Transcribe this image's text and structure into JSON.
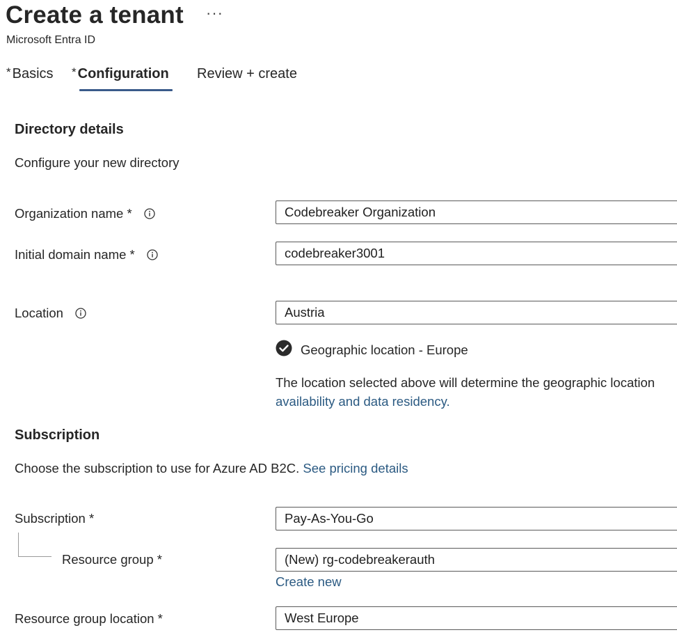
{
  "header": {
    "title": "Create a tenant",
    "more_label": "···",
    "subtitle": "Microsoft Entra ID"
  },
  "tabs": [
    {
      "label": "Basics",
      "required_marker": "*",
      "active": false
    },
    {
      "label": "Configuration",
      "required_marker": "*",
      "active": true
    },
    {
      "label": "Review + create",
      "required_marker": "",
      "active": false
    }
  ],
  "directory": {
    "heading": "Directory details",
    "description": "Configure your new directory",
    "org_name": {
      "label": "Organization name *",
      "value": "Codebreaker Organization"
    },
    "domain_name": {
      "label": "Initial domain name *",
      "value": "codebreaker3001"
    },
    "location": {
      "label": "Location",
      "value": "Austria",
      "geo_text": "Geographic location - Europe",
      "note_line1": "The location selected above will determine the geographic location",
      "note_line2": "availability and data residency."
    }
  },
  "subscription": {
    "heading": "Subscription",
    "description": "Choose the subscription to use for Azure AD B2C.",
    "pricing_link": "See pricing details",
    "subscription_field": {
      "label": "Subscription *",
      "value": "Pay-As-You-Go"
    },
    "resource_group": {
      "label": "Resource group *",
      "value": "(New) rg-codebreakerauth",
      "create_new": "Create new"
    },
    "rg_location": {
      "label": "Resource group location *",
      "value": "West Europe"
    }
  },
  "colors": {
    "accent_underline": "#3a5a8a",
    "link": "#2b5a82"
  },
  "icons": [
    "info-icon",
    "checkmark-circle-icon",
    "more-icon"
  ]
}
